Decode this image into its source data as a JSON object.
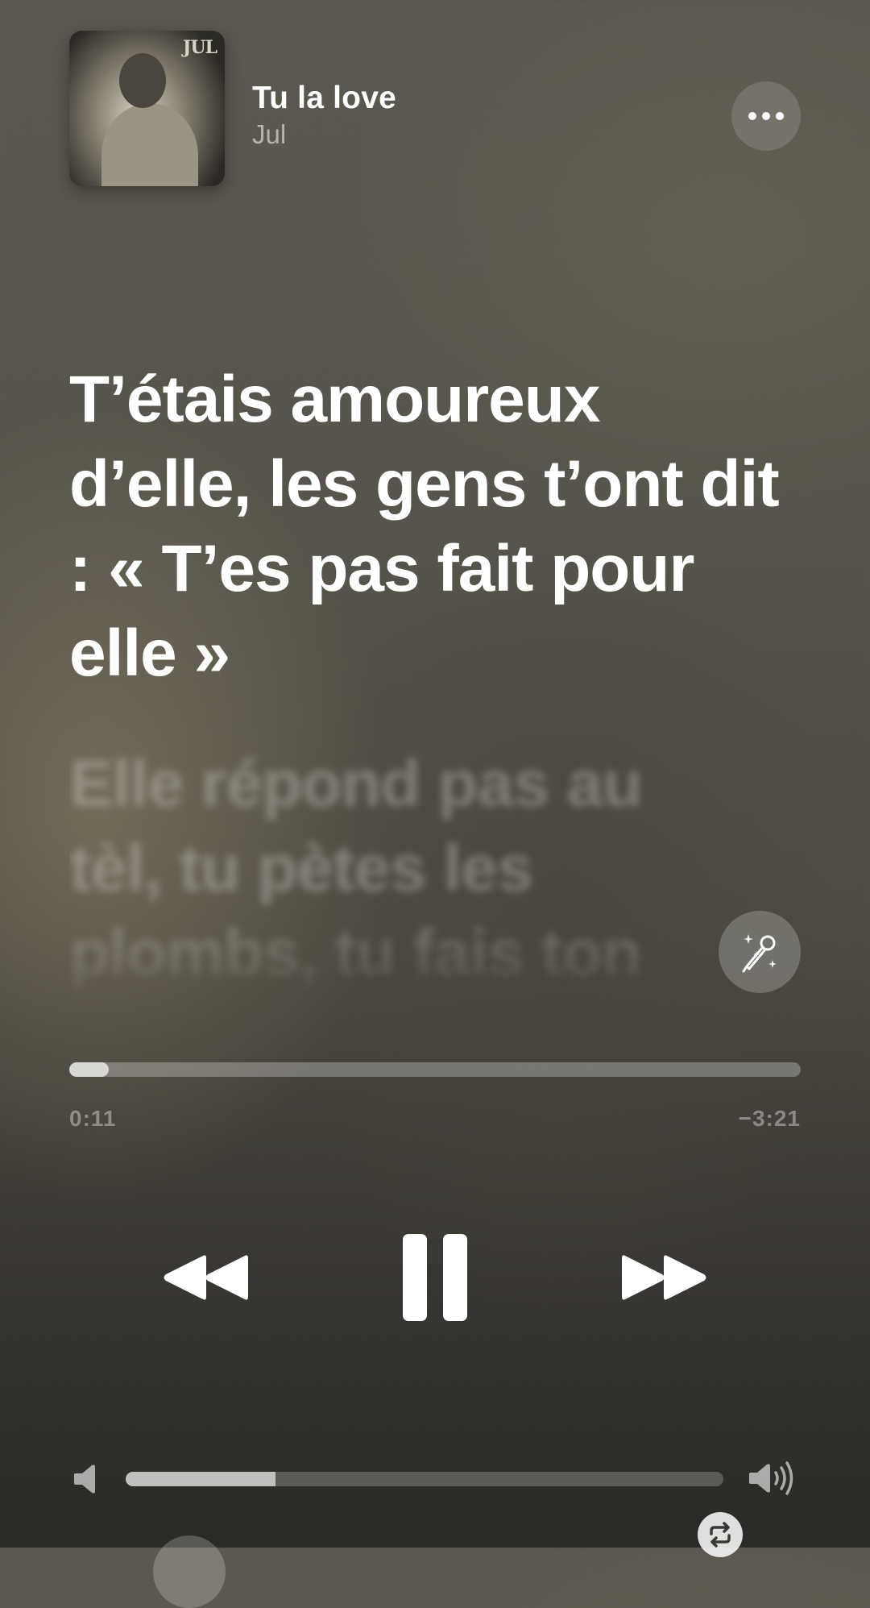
{
  "now_playing": {
    "title": "Tu la love",
    "artist": "Jul",
    "artwork_text": "JUL"
  },
  "lyrics": {
    "active": "T’étais amoureux d’elle, les gens t’ont dit : « T’es pas fait pour elle »",
    "next": "Elle répond pas au tèl, tu pètes les plombs, tu fais ton"
  },
  "playback": {
    "elapsed": "0:11",
    "remaining": "−3:21",
    "progress_fraction": 0.054,
    "state": "playing"
  },
  "volume": {
    "level_fraction": 0.25
  },
  "icons": {
    "more": "ellipsis-icon",
    "sing": "microphone-sparkles-icon",
    "rewind": "rewind-icon",
    "pause": "pause-icon",
    "forward": "fast-forward-icon",
    "volume_low": "speaker-low-icon",
    "volume_high": "speaker-high-icon",
    "repeat": "repeat-icon"
  },
  "colors": {
    "foreground": "#ffffff",
    "background_top": "#5b5850",
    "background_bottom": "#2c2a27"
  }
}
